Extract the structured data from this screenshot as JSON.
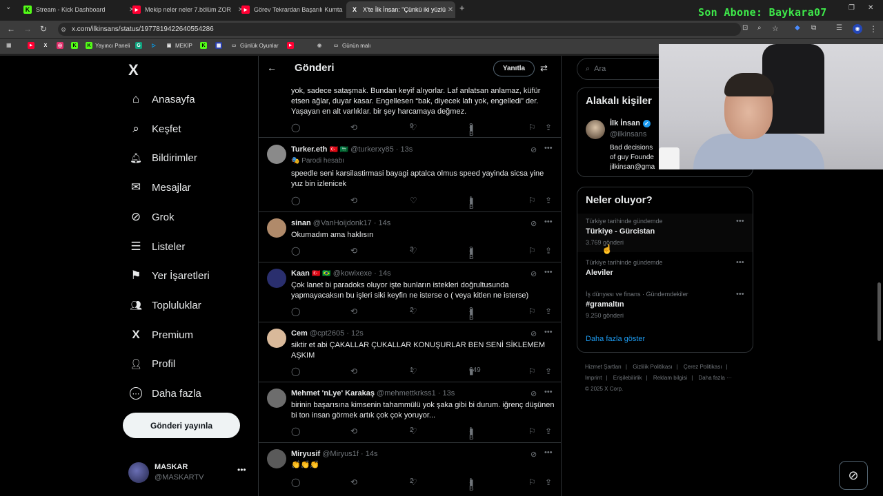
{
  "browser": {
    "tabs": [
      {
        "title": "Stream - Kick Dashboard",
        "icon": "K",
        "icon_color": "#53fc18"
      },
      {
        "title": "Mekip neler neler 7.bölüm ZOR",
        "icon": "▶",
        "icon_color": "#ff0033"
      },
      {
        "title": "Görev Tekrardan Başarılı Kumta",
        "icon": "▶",
        "icon_color": "#ff0033"
      },
      {
        "title": "X'te İlk İnsan: \"Çünkü iki yüzlü",
        "icon": "X",
        "icon_color": "#ffffff"
      }
    ],
    "subscriber_banner": "Son Abone: Baykara07",
    "url": "x.com/ilkinsans/status/1977819422640554286",
    "bookmarks": [
      {
        "label": "",
        "icon": "▶",
        "color": "#ff0033"
      },
      {
        "label": "",
        "icon": "X",
        "color": "#ffffff"
      },
      {
        "label": "",
        "icon": "◎",
        "color": "#e1306c"
      },
      {
        "label": "",
        "icon": "K",
        "color": "#53fc18"
      },
      {
        "label": "Yayıncı Paneli",
        "icon": "K",
        "color": "#53fc18"
      },
      {
        "label": "",
        "icon": "G",
        "color": "#10a37f"
      },
      {
        "label": "",
        "icon": "▷",
        "color": "#00aaff"
      },
      {
        "label": "MEKİP",
        "icon": "▣",
        "color": "#e5e5e5"
      },
      {
        "label": "",
        "icon": "K",
        "color": "#53fc18"
      },
      {
        "label": "",
        "icon": "▦",
        "color": "#2b3fa8"
      },
      {
        "label": "Günlük Oyunlar",
        "icon": "▭",
        "color": "#bbbbbb"
      },
      {
        "label": "",
        "icon": "▶",
        "color": "#ff0033"
      },
      {
        "label": "",
        "icon": "◉",
        "color": "#bbbbbb"
      },
      {
        "label": "Günün malı",
        "icon": "▭",
        "color": "#bbbbbb"
      }
    ]
  },
  "sidebar": {
    "logo": "X",
    "items": [
      {
        "label": "Anasayfa",
        "icon": "⌂"
      },
      {
        "label": "Keşfet",
        "icon": "⌕"
      },
      {
        "label": "Bildirimler",
        "icon": "🔔︎"
      },
      {
        "label": "Mesajlar",
        "icon": "✉"
      },
      {
        "label": "Grok",
        "icon": "⊘"
      },
      {
        "label": "Listeler",
        "icon": "☰"
      },
      {
        "label": "Yer İşaretleri",
        "icon": "⚑"
      },
      {
        "label": "Topluluklar",
        "icon": "👥︎"
      },
      {
        "label": "Premium",
        "icon": "X"
      },
      {
        "label": "Profil",
        "icon": "👤︎"
      },
      {
        "label": "Daha fazla",
        "icon": "⋯"
      }
    ],
    "post_button": "Gönderi yayınla",
    "account": {
      "name": "MASKAR",
      "handle": "@MASKARTV"
    }
  },
  "feed": {
    "title": "Gönderi",
    "reply_button": "Yanıtla",
    "partial_tweet": {
      "text": "yok, sadece sataşmak. Bundan keyif alıyorlar. Laf anlatsan anlamaz, küfür etsen ağlar, duyar kasar. Engellesen “bak, diyecek lafı yok, engelledi” der. Yaşayan en alt varlıklar. bir şey harcamaya değmez.",
      "likes": "9",
      "views": "3 B"
    },
    "tweets": [
      {
        "name": "Turker.eth",
        "flags": "🇹🇷 🇸🇦",
        "meta": "@turkerxy85 · 13s",
        "parody": "🎭 Parodi hesabı",
        "text": "speedle seni karsilastirmasi bayagi aptalca olmus speed yayinda sicsa yine yuz bin izlenicek",
        "likes": "",
        "views": "1 B",
        "avatar": "#8a8a8a"
      },
      {
        "name": "sinan",
        "flags": "",
        "meta": "@VanHoijdonk17 · 14s",
        "parody": "",
        "text": "Okumadım ama haklısın",
        "likes": "3",
        "views": "2 B",
        "avatar": "#b08a6a"
      },
      {
        "name": "Kaan",
        "flags": "🇹🇷 🇧🇷",
        "meta": "@kowixexe · 14s",
        "parody": "",
        "text": "Çok lanet bi paradoks oluyor işte bunların istekleri doğrultusunda yapmayacaksın bu işleri siki keyfin ne isterse o ( veya kitlen ne isterse)",
        "likes": "2",
        "views": "2 B",
        "avatar": "#2a2f6e"
      },
      {
        "name": "Cem",
        "flags": "",
        "meta": "@cpt2605 · 12s",
        "parody": "",
        "text": "siktir et abi ÇAKALLAR ÇUKALLAR KONUŞURLAR BEN SENİ SİKLEMEM AŞKIM",
        "likes": "1",
        "views": "649",
        "avatar": "#d9b99a"
      },
      {
        "name": "Mehmet 'nLye' Karakaş",
        "flags": "",
        "meta": "@mehmettkrkss1 · 13s",
        "parody": "",
        "text": "birinin başarısına kimsenin tahammülü yok şaka gibi bi durum. iğrenç düşünen bi ton insan görmek artık çok çok yoruyor...",
        "likes": "2",
        "views": "1 B",
        "avatar": "#6d6d6d"
      },
      {
        "name": "Miryusif",
        "flags": "",
        "meta": "@Miryus1f · 14s",
        "parody": "",
        "text": "👏👏👏",
        "likes": "2",
        "views": "1 B",
        "avatar": "#5a5a5a"
      }
    ]
  },
  "right": {
    "search_placeholder": "Ara",
    "related_title": "Alakalı kişiler",
    "person": {
      "name": "İlk İnsan",
      "handle": "@ilkinsans",
      "bio_line1": "Bad decisions",
      "bio_line2": "of guy Founde",
      "bio_line3": "jilkinsan@gma"
    },
    "trends_title": "Neler oluyor?",
    "trends": [
      {
        "context": "Türkiye tarihinde gündemde",
        "title": "Türkiye - Gürcistan",
        "count": "3.769 gönderi"
      },
      {
        "context": "Türkiye tarihinde gündemde",
        "title": "Aleviler",
        "count": ""
      },
      {
        "context": "İş dünyası ve finans · Gündemdekiler",
        "title": "#gramaltın",
        "count": "9.250 gönderi"
      }
    ],
    "show_more": "Daha fazla göster",
    "footer_line1": [
      "Hizmet Şartları",
      "|",
      "Gizlilik Politikası",
      "|",
      "Çerez Politikası",
      "|"
    ],
    "footer_line2": [
      "Imprint",
      "|",
      "Erişilebilirlik",
      "|",
      "Reklam bilgisi",
      "|",
      "Daha fazla ···"
    ],
    "footer_copy": "© 2025 X Corp."
  },
  "colors": {
    "accent": "#1d9bf0",
    "border": "#2f3336",
    "muted": "#71767b",
    "kick_green": "#53fc18",
    "banner_green": "#3ee84a"
  }
}
